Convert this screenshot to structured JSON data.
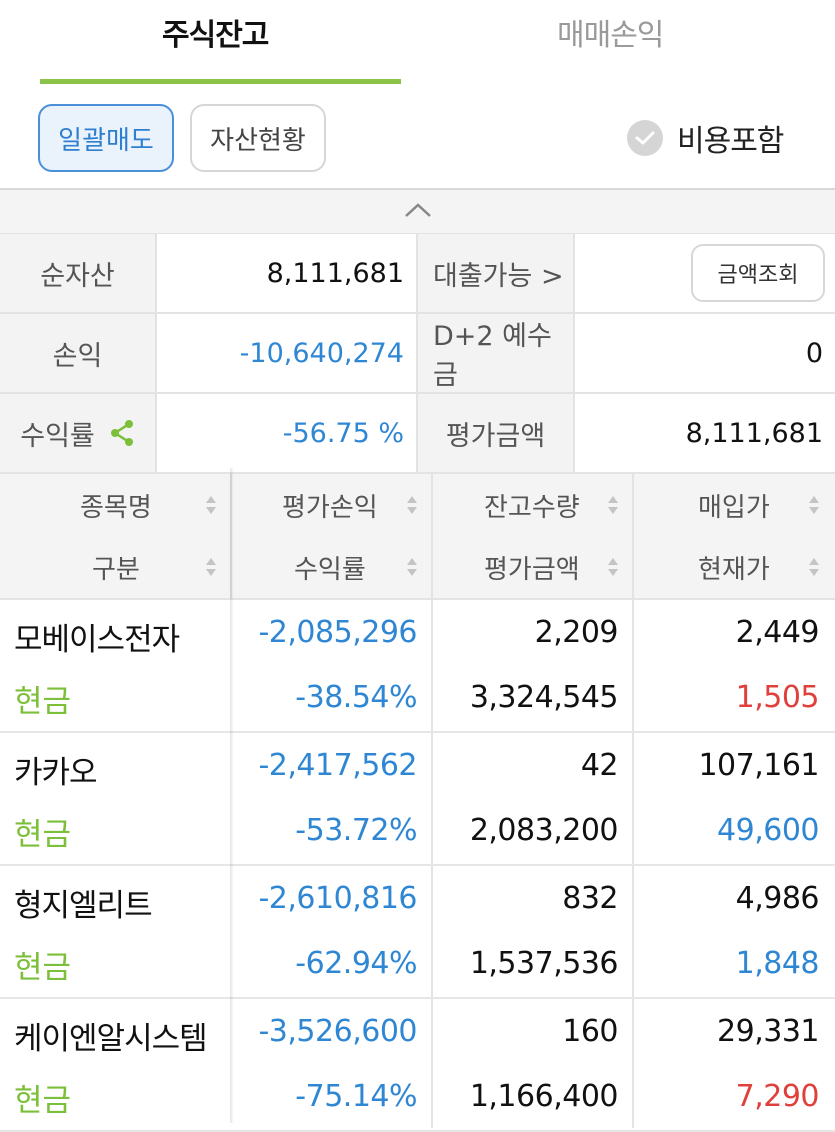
{
  "tabs": [
    {
      "label": "주식잔고",
      "active": true
    },
    {
      "label": "매매손익",
      "active": false
    }
  ],
  "buttons": {
    "bulk_sell": "일괄매도",
    "asset_status": "자산현황"
  },
  "fee_toggle": {
    "label": "비용포함",
    "checked": false
  },
  "summary": {
    "net_assets_label": "순자산",
    "net_assets_value": "8,111,681",
    "loan_label": "대출가능 >",
    "inquiry_button": "금액조회",
    "pnl_label": "손익",
    "pnl_value": "-10,640,274",
    "deposit_label": "D+2 예수금",
    "deposit_value": "0",
    "return_label": "수익률",
    "return_value": "-56.75 %",
    "eval_label": "평가금액",
    "eval_value": "8,111,681"
  },
  "table": {
    "headers": {
      "name": "종목명",
      "type": "구분",
      "eval_pnl": "평가손익",
      "return_rate": "수익률",
      "quantity": "잔고수량",
      "eval_amount": "평가금액",
      "buy_price": "매입가",
      "current_price": "현재가"
    },
    "rows": [
      {
        "name": "모베이스전자",
        "type": "현금",
        "eval_pnl": "-2,085,296",
        "return_rate": "-38.54%",
        "quantity": "2,209",
        "eval_amount": "3,324,545",
        "buy_price": "2,449",
        "current_price": "1,505",
        "current_color": "#e0403c"
      },
      {
        "name": "카카오",
        "type": "현금",
        "eval_pnl": "-2,417,562",
        "return_rate": "-53.72%",
        "quantity": "42",
        "eval_amount": "2,083,200",
        "buy_price": "107,161",
        "current_price": "49,600",
        "current_color": "#2f87d4"
      },
      {
        "name": "형지엘리트",
        "type": "현금",
        "eval_pnl": "-2,610,816",
        "return_rate": "-62.94%",
        "quantity": "832",
        "eval_amount": "1,537,536",
        "buy_price": "4,986",
        "current_price": "1,848",
        "current_color": "#2f87d4"
      },
      {
        "name": "케이엔알시스템",
        "type": "현금",
        "eval_pnl": "-3,526,600",
        "return_rate": "-75.14%",
        "quantity": "160",
        "eval_amount": "1,166,400",
        "buy_price": "29,331",
        "current_price": "7,290",
        "current_color": "#e0403c"
      }
    ]
  },
  "colors": {
    "accent_green": "#8bc34a",
    "negative_blue": "#2f87d4",
    "up_red": "#e0403c"
  }
}
